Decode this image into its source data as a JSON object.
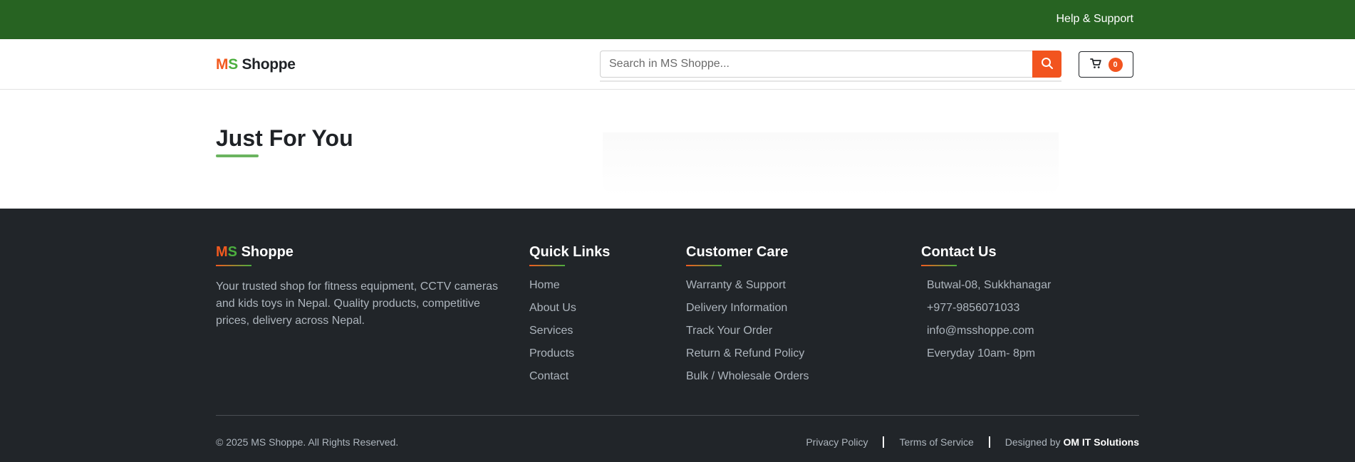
{
  "topbar": {
    "help_label": "Help & Support"
  },
  "header": {
    "logo": {
      "m": "M",
      "s": "S",
      "rest": " Shoppe"
    },
    "search": {
      "placeholder": "Search in MS Shoppe..."
    },
    "cart": {
      "count": "0"
    }
  },
  "main": {
    "section_title": "Just For You"
  },
  "footer": {
    "brand": {
      "m": "M",
      "s": "S",
      "rest": " Shoppe"
    },
    "description": "Your trusted shop for fitness equipment, CCTV cameras and kids toys in Nepal. Quality products, competitive prices, delivery across Nepal.",
    "quick_links": {
      "title": "Quick Links",
      "items": [
        "Home",
        "About Us",
        "Services",
        "Products",
        "Contact"
      ]
    },
    "customer_care": {
      "title": "Customer Care",
      "items": [
        "Warranty & Support",
        "Delivery Information",
        "Track Your Order",
        "Return & Refund Policy",
        "Bulk / Wholesale Orders"
      ]
    },
    "contact": {
      "title": "Contact Us",
      "items": [
        "Butwal-08, Sukkhanagar",
        "+977-9856071033",
        "info@msshoppe.com",
        "Everyday 10am- 8pm"
      ]
    },
    "bottom": {
      "copyright": "© 2025 MS Shoppe. All Rights Reserved.",
      "privacy": "Privacy Policy",
      "terms": "Terms of Service",
      "designed_by": "Designed by",
      "designer": "OM IT Solutions"
    }
  },
  "colors": {
    "topbar": "#276322",
    "accent": "#f2541f",
    "brand_green": "#4caf3f",
    "footer_bg": "#212529"
  },
  "icons": {
    "search": "search-icon",
    "cart": "cart-icon"
  }
}
